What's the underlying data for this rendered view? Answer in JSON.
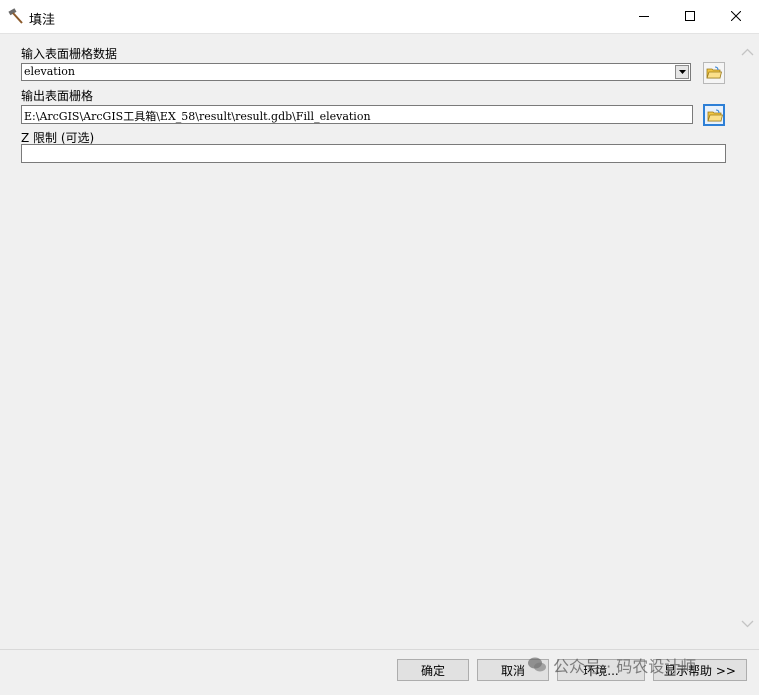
{
  "window": {
    "title": "填洼",
    "icon": "hammer-icon"
  },
  "form": {
    "input_label": "输入表面栅格数据",
    "input_value": "elevation",
    "output_label": "输出表面栅格",
    "output_value": "E:\\ArcGIS\\ArcGIS工具箱\\EX_58\\result\\result.gdb\\Fill_elevation",
    "z_label": "Z 限制 (可选)",
    "z_value": ""
  },
  "buttons": {
    "ok": "确定",
    "cancel": "取消",
    "environment": "环境...",
    "help": "显示帮助 >>"
  },
  "watermark": "公众号 · 码农设计师",
  "icons": [
    "hammer-icon",
    "minimize-icon",
    "maximize-icon",
    "close-icon",
    "folder-open-icon",
    "chevron-down-icon",
    "scroll-up-icon",
    "scroll-down-icon",
    "wechat-icon"
  ],
  "colors": {
    "accent": "#2d7fd6",
    "folder": "#f2c744",
    "background": "#f0f0f0"
  }
}
